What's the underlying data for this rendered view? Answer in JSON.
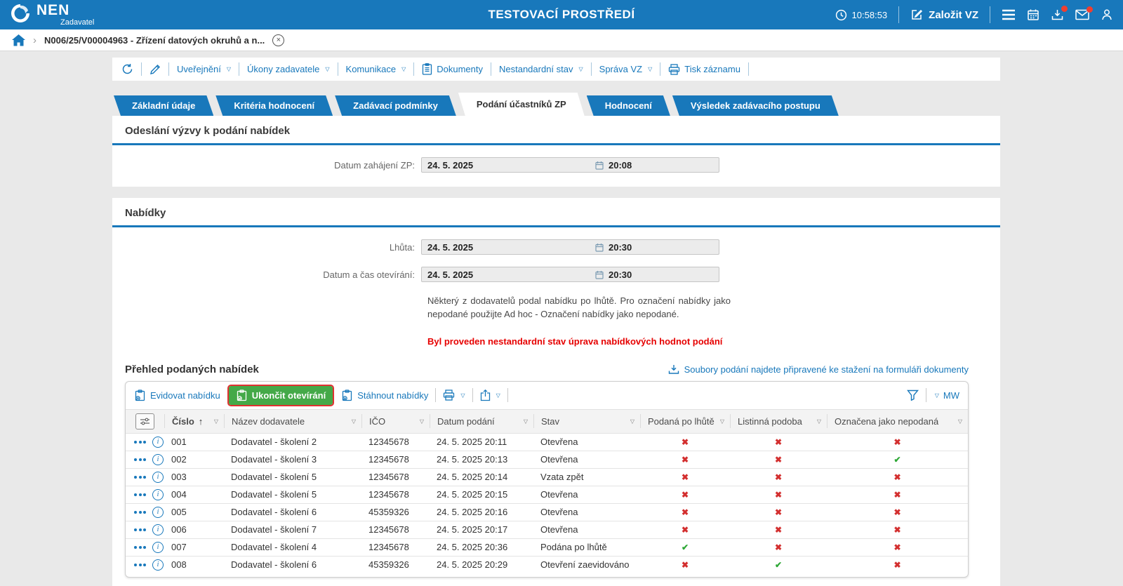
{
  "icons": {
    "caret": "▽",
    "sort_asc": "↑",
    "info": "i",
    "close": "×",
    "chevron": "›",
    "check": "✔",
    "cross": "✖"
  },
  "colors": {
    "brand_blue": "#1878BB",
    "green": "#44A948",
    "red_mark": "#D32F2F",
    "green_mark": "#2EA836",
    "warning_red": "#E60000",
    "badge_red": "#F03E2F"
  },
  "topbar": {
    "brand": "NEN",
    "brand_sub": "Zadavatel",
    "env_title": "TESTOVACÍ PROSTŘEDÍ",
    "time": "10:58:53",
    "create_vz": "Založit VZ"
  },
  "breadcrumb": {
    "title": "N006/25/V00004963 - Zřízení datových okruhů a n..."
  },
  "toolbar": {
    "items": [
      {
        "label": "Uveřejnění",
        "caret": true
      },
      {
        "label": "Úkony zadavatele",
        "caret": true
      },
      {
        "label": "Komunikace",
        "caret": true
      },
      {
        "label": "Dokumenty",
        "caret": false
      },
      {
        "label": "Nestandardní stav",
        "caret": true
      },
      {
        "label": "Správa VZ",
        "caret": true
      },
      {
        "label": "Tisk záznamu",
        "caret": false
      }
    ]
  },
  "tabs": {
    "items": [
      "Základní údaje",
      "Kritéria hodnocení",
      "Zadávací podmínky",
      "Podání účastníků ZP",
      "Hodnocení",
      "Výsledek zadávacího postupu"
    ],
    "active_index": 3
  },
  "section_odeslani": {
    "title": "Odeslání výzvy k podání nabídek",
    "field_label": "Datum zahájení ZP:",
    "date": "24. 5. 2025",
    "time": "20:08"
  },
  "section_nabidky": {
    "title": "Nabídky",
    "fields": [
      {
        "label": "Lhůta:",
        "date": "24. 5. 2025",
        "time": "20:30"
      },
      {
        "label": "Datum a čas otevírání:",
        "date": "24. 5. 2025",
        "time": "20:30"
      }
    ],
    "note": "Některý z dodavatelů podal nabídku po lhůtě. Pro označení nabídky jako nepodané použijte Ad hoc - Označení nabídky jako nepodané.",
    "warning": "Byl proveden nestandardní stav úprava nabídkových hodnot podání"
  },
  "table": {
    "title": "Přehled podaných nabídek",
    "files_link": "Soubory podání najdete připravené ke stažení na formuláři dokumenty",
    "actions": {
      "evidovat": "Evidovat nabídku",
      "ukoncit": "Ukončit otevírání",
      "stahnout": "Stáhnout nabídky"
    },
    "mw_label": "MW",
    "columns": [
      "Číslo",
      "Název dodavatele",
      "IČO",
      "Datum podání",
      "Stav",
      "Podaná po lhůtě",
      "Listinná podoba",
      "Označena jako nepodaná"
    ],
    "sorted_column": "Číslo",
    "rows": [
      {
        "cislo": "001",
        "nazev": "Dodavatel - školení 2",
        "ico": "12345678",
        "datum": "24. 5. 2025 20:11",
        "stav": "Otevřena",
        "po_lhute": false,
        "listinna": false,
        "nepodana": false
      },
      {
        "cislo": "002",
        "nazev": "Dodavatel - školení 3",
        "ico": "12345678",
        "datum": "24. 5. 2025 20:13",
        "stav": "Otevřena",
        "po_lhute": false,
        "listinna": false,
        "nepodana": true
      },
      {
        "cislo": "003",
        "nazev": "Dodavatel - školení 5",
        "ico": "12345678",
        "datum": "24. 5. 2025 20:14",
        "stav": "Vzata zpět",
        "po_lhute": false,
        "listinna": false,
        "nepodana": false
      },
      {
        "cislo": "004",
        "nazev": "Dodavatel - školení 5",
        "ico": "12345678",
        "datum": "24. 5. 2025 20:15",
        "stav": "Otevřena",
        "po_lhute": false,
        "listinna": false,
        "nepodana": false
      },
      {
        "cislo": "005",
        "nazev": "Dodavatel - školení 6",
        "ico": "45359326",
        "datum": "24. 5. 2025 20:16",
        "stav": "Otevřena",
        "po_lhute": false,
        "listinna": false,
        "nepodana": false
      },
      {
        "cislo": "006",
        "nazev": "Dodavatel - školení 7",
        "ico": "12345678",
        "datum": "24. 5. 2025 20:17",
        "stav": "Otevřena",
        "po_lhute": false,
        "listinna": false,
        "nepodana": false
      },
      {
        "cislo": "007",
        "nazev": "Dodavatel - školení 4",
        "ico": "12345678",
        "datum": "24. 5. 2025 20:36",
        "stav": "Podána po lhůtě",
        "po_lhute": true,
        "listinna": false,
        "nepodana": false
      },
      {
        "cislo": "008",
        "nazev": "Dodavatel - školení 6",
        "ico": "45359326",
        "datum": "24. 5. 2025 20:29",
        "stav": "Otevření zaevidováno",
        "po_lhute": false,
        "listinna": true,
        "nepodana": false
      }
    ]
  }
}
